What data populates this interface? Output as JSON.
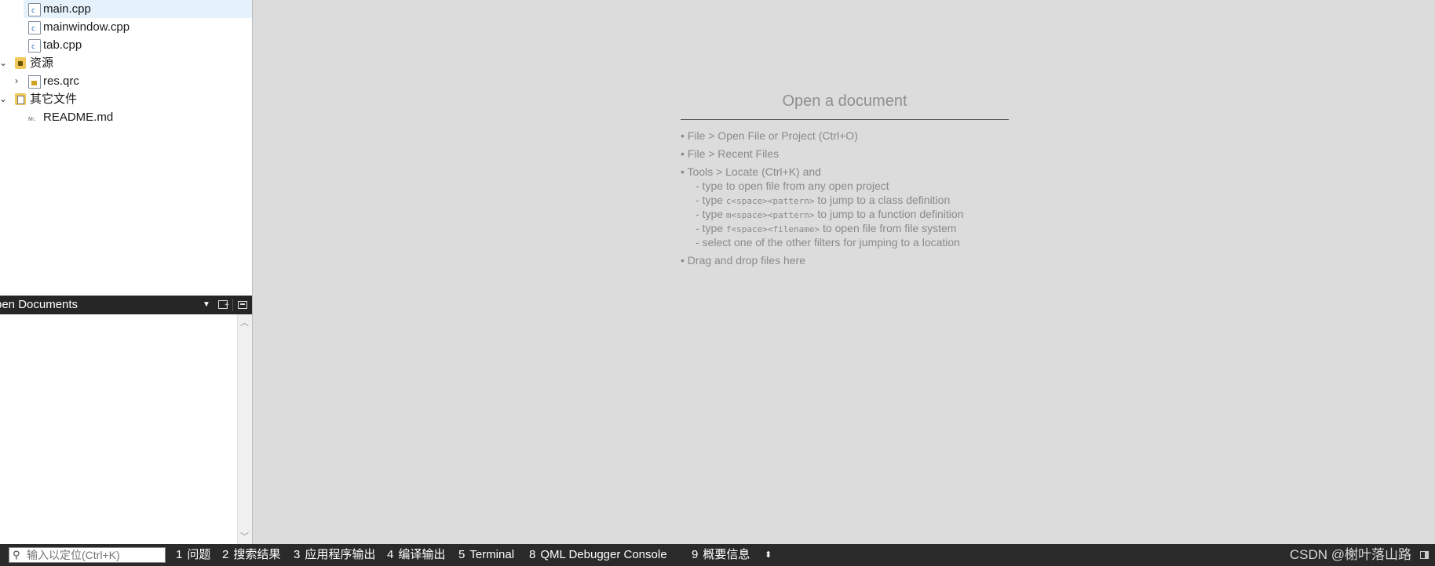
{
  "project_tree": {
    "items": [
      {
        "label": "main.cpp",
        "icon": "cpp-file-icon",
        "selected": true
      },
      {
        "label": "mainwindow.cpp",
        "icon": "cpp-file-icon"
      },
      {
        "label": "tab.cpp",
        "icon": "cpp-file-icon"
      },
      {
        "label": "资源",
        "icon": "resource-folder-icon",
        "expanded": true
      },
      {
        "label": "res.qrc",
        "icon": "qrc-file-icon",
        "expanded": false
      },
      {
        "label": "其它文件",
        "icon": "other-files-folder-icon",
        "expanded": true
      },
      {
        "label": "README.md",
        "icon": "markdown-file-icon"
      }
    ]
  },
  "open_documents": {
    "title": "pen Documents"
  },
  "welcome": {
    "heading": "Open a document",
    "items": [
      "• File > Open File or Project (Ctrl+O)",
      "• File > Recent Files",
      "• Tools > Locate (Ctrl+K) and",
      "• Drag and drop files here"
    ],
    "subitems": {
      "s1": "- type to open file from any open project",
      "s2_pre": "- type ",
      "s2_code": "c<space><pattern>",
      "s2_post": " to jump to a class definition",
      "s3_pre": "- type ",
      "s3_code": "m<space><pattern>",
      "s3_post": " to jump to a function definition",
      "s4_pre": "- type ",
      "s4_code": "f<space><filename>",
      "s4_post": " to open file from file system",
      "s5": "- select one of the other filters for jumping to a location"
    }
  },
  "statusbar": {
    "locator_placeholder": "输入以定位(Ctrl+K)",
    "tabs": [
      {
        "num": "1",
        "label": "问题"
      },
      {
        "num": "2",
        "label": "搜索结果"
      },
      {
        "num": "3",
        "label": "应用程序输出"
      },
      {
        "num": "4",
        "label": "编译输出"
      },
      {
        "num": "5",
        "label": "Terminal"
      },
      {
        "num": "8",
        "label": "QML Debugger Console"
      },
      {
        "num": "9",
        "label": "概要信息"
      }
    ],
    "watermark": "CSDN @榭叶落山路"
  },
  "colors": {
    "editor_bg": "#dcdcdc",
    "statusbar_bg": "#2a2a2a",
    "selection_bg": "#e5f1fb"
  }
}
